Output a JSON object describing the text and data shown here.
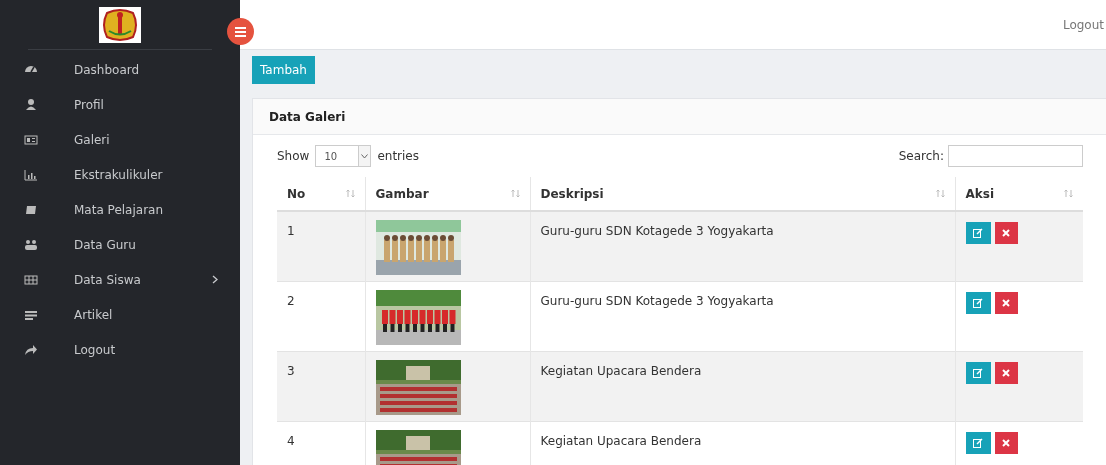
{
  "sidebar": {
    "items": [
      {
        "label": "Dashboard",
        "has_submenu": false
      },
      {
        "label": "Profil",
        "has_submenu": false
      },
      {
        "label": "Galeri",
        "has_submenu": false
      },
      {
        "label": "Ekstrakulikuler",
        "has_submenu": false
      },
      {
        "label": "Mata Pelajaran",
        "has_submenu": false
      },
      {
        "label": "Data Guru",
        "has_submenu": false
      },
      {
        "label": "Data Siswa",
        "has_submenu": true
      },
      {
        "label": "Artikel",
        "has_submenu": false
      },
      {
        "label": "Logout",
        "has_submenu": false
      }
    ]
  },
  "topbar": {
    "logout": "Logout"
  },
  "add_button": "Tambah",
  "card": {
    "title": "Data Galeri",
    "length": {
      "show": "Show",
      "value": "10",
      "suffix": "entries"
    },
    "search": {
      "label": "Search:"
    },
    "table": {
      "columns": [
        "No",
        "Gambar",
        "Deskripsi",
        "Aksi"
      ],
      "rows": [
        {
          "no": "1",
          "description": "Guru-guru SDN Kotagede 3 Yogyakarta"
        },
        {
          "no": "2",
          "description": "Guru-guru SDN Kotagede 3 Yogyakarta"
        },
        {
          "no": "3",
          "description": "Kegiatan Upacara Bendera"
        },
        {
          "no": "4",
          "description": "Kegiatan Upacara Bendera"
        }
      ]
    }
  }
}
